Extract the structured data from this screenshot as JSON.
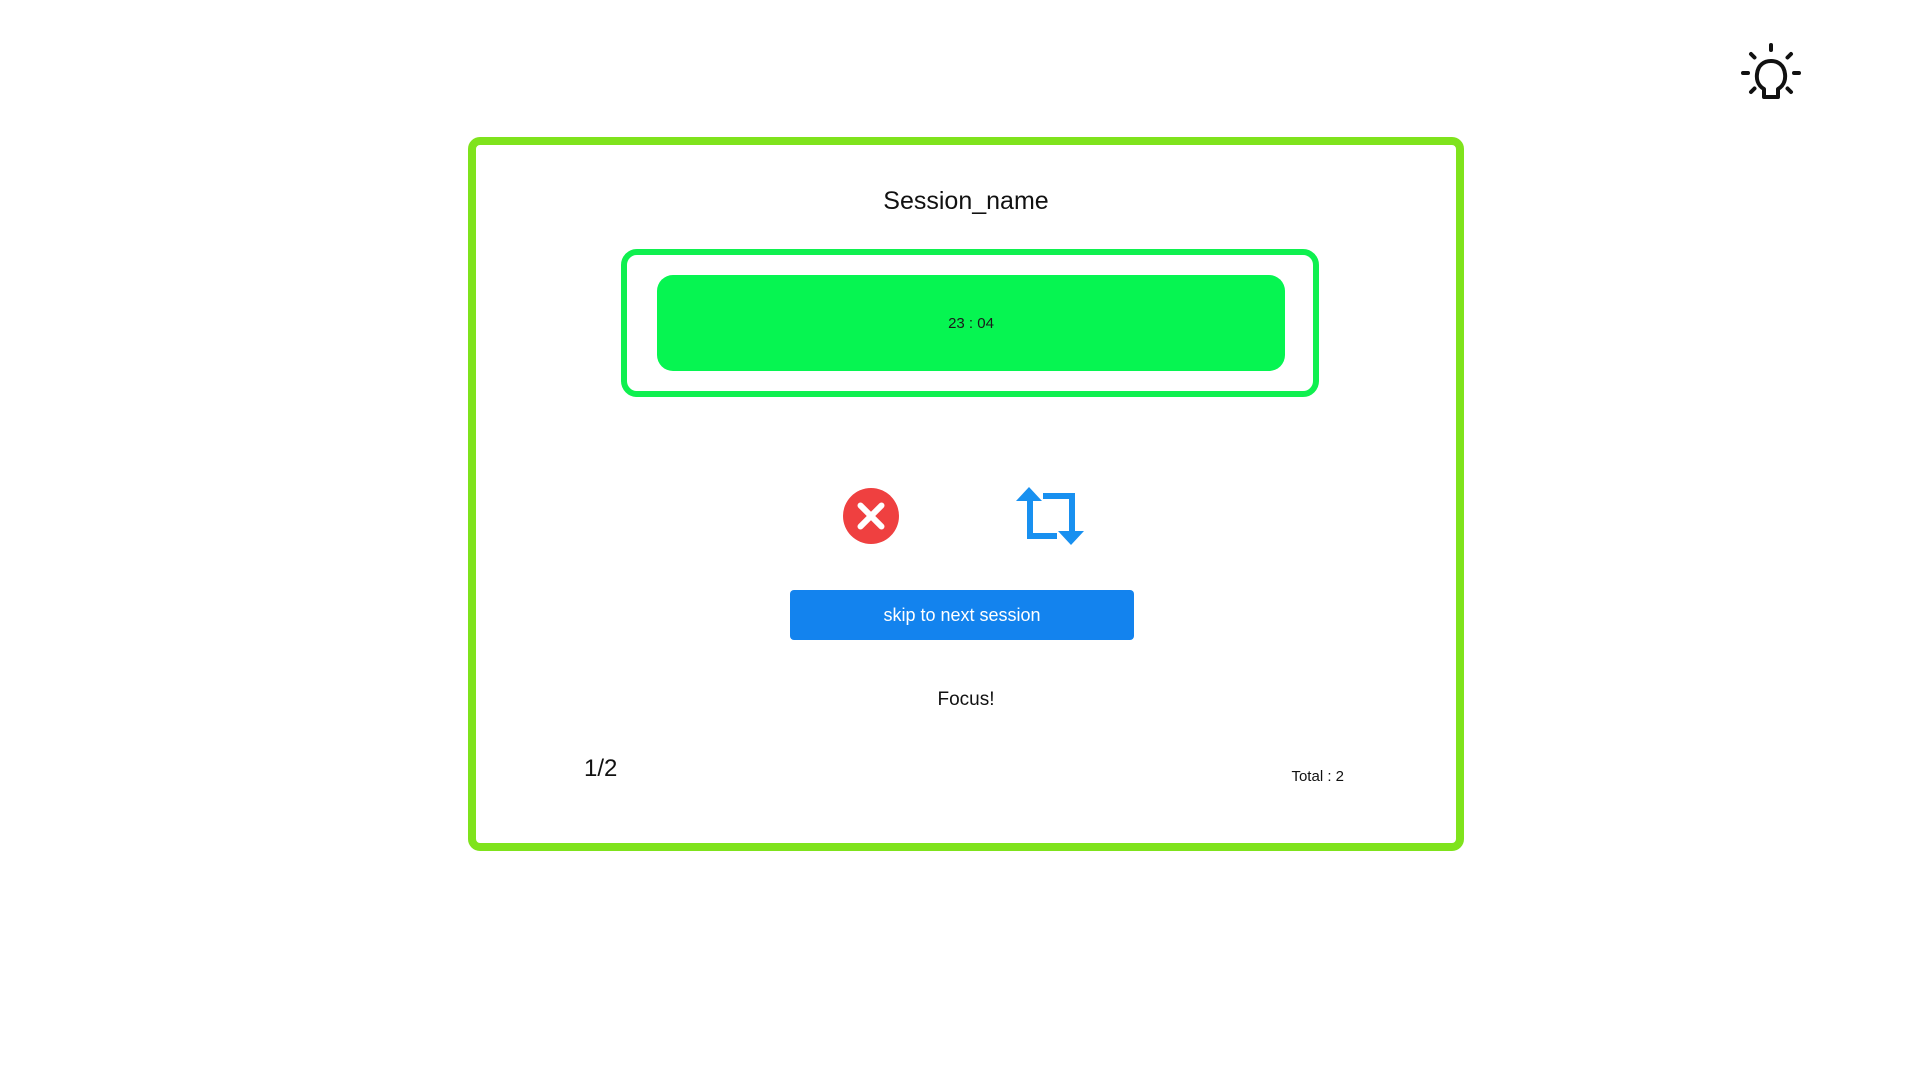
{
  "theme_toggle": {
    "icon": "lightbulb-icon"
  },
  "session": {
    "name": "Session_name",
    "timer": "23 : 04",
    "status": "Focus!",
    "progress": "1/2",
    "total": "Total : 2"
  },
  "controls": {
    "cancel_icon": "close-circle-icon",
    "repeat_icon": "repeat-icon",
    "skip_label": "skip to next session"
  },
  "colors": {
    "card_border": "#7fe31c",
    "timer_border": "#0ff04f",
    "timer_fill": "#06f551",
    "primary": "#1383ee",
    "danger": "#ef4040"
  }
}
